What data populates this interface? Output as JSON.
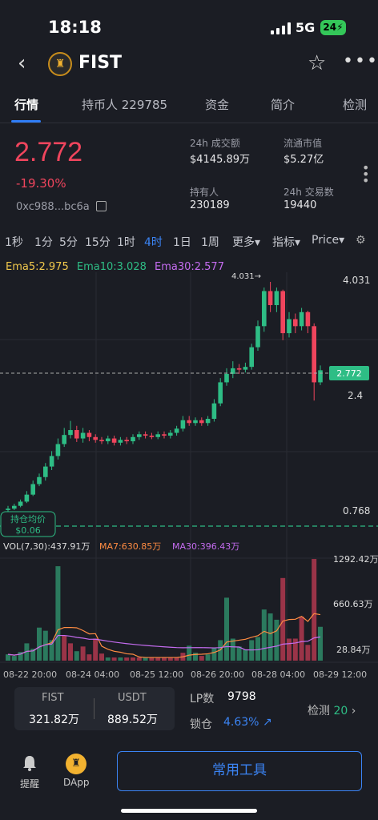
{
  "status": {
    "time": "18:18",
    "network": "5G",
    "battery": "24"
  },
  "header": {
    "title": "FIST",
    "logo_text": "♜"
  },
  "tabs": [
    {
      "label": "行情",
      "active": true
    },
    {
      "label": "持币人 229785"
    },
    {
      "label": "资金"
    },
    {
      "label": "简介"
    },
    {
      "label": "检测"
    }
  ],
  "overview": {
    "price": "2.772",
    "change": "-19.30%",
    "address": "0xc988...bc6a",
    "stats": [
      {
        "label": "24h 成交额",
        "value": "$4145.89万"
      },
      {
        "label": "流通市值",
        "value": "$5.27亿"
      },
      {
        "label": "持有人",
        "value": "230189"
      },
      {
        "label": "24h 交易数",
        "value": "19440"
      }
    ]
  },
  "timeframes": [
    "1秒",
    "1分",
    "5分",
    "15分",
    "1时",
    "4时",
    "1日",
    "1周",
    "更多▾",
    "指标▾",
    "Price▾"
  ],
  "active_timeframe": "4时",
  "ema": {
    "ema5": "Ema5:2.975",
    "ema10": "Ema10:3.028",
    "ema30": "Ema30:2.577"
  },
  "chart_labels": {
    "high_marker": "4.031→",
    "price_axis": [
      "4.031",
      "2.4",
      "0.768"
    ],
    "current_price": "2.772",
    "avg_cost_label": "持仓均价",
    "avg_cost_value": "$0.06",
    "vol": "VOL(7,30):437.91万",
    "ma7": "MA7:630.85万",
    "ma30": "MA30:396.43万",
    "vol_axis": [
      "1292.42万",
      "660.63万",
      "28.84万"
    ],
    "dates": [
      "08-22 20:00",
      "08-24 04:00",
      "08-25 12:00",
      "08-26 20:00",
      "08-28 04:00",
      "08-29 12:00"
    ]
  },
  "colors": {
    "up": "#2ebd85",
    "down": "#f0455d",
    "accent": "#3b84f4",
    "ema5": "#f2c94c",
    "ema10": "#2ebd85",
    "ema30": "#c56cf0",
    "ma7": "#ff8c42"
  },
  "chart_data": {
    "type": "candlestick",
    "price_range": [
      0.768,
      4.031
    ],
    "candles": [
      {
        "o": 0.78,
        "c": 0.8,
        "h": 0.84,
        "l": 0.76
      },
      {
        "o": 0.8,
        "c": 0.84,
        "h": 0.87,
        "l": 0.78
      },
      {
        "o": 0.84,
        "c": 0.9,
        "h": 0.93,
        "l": 0.82
      },
      {
        "o": 0.9,
        "c": 1.0,
        "h": 1.05,
        "l": 0.88
      },
      {
        "o": 1.0,
        "c": 1.15,
        "h": 1.2,
        "l": 0.98
      },
      {
        "o": 1.15,
        "c": 1.25,
        "h": 1.3,
        "l": 1.12
      },
      {
        "o": 1.25,
        "c": 1.4,
        "h": 1.45,
        "l": 1.2
      },
      {
        "o": 1.4,
        "c": 1.55,
        "h": 1.62,
        "l": 1.35
      },
      {
        "o": 1.55,
        "c": 1.72,
        "h": 1.8,
        "l": 1.5
      },
      {
        "o": 1.72,
        "c": 1.85,
        "h": 1.95,
        "l": 1.68
      },
      {
        "o": 1.85,
        "c": 1.92,
        "h": 2.05,
        "l": 1.8
      },
      {
        "o": 1.92,
        "c": 1.8,
        "h": 1.98,
        "l": 1.75
      },
      {
        "o": 1.8,
        "c": 1.88,
        "h": 1.95,
        "l": 1.74
      },
      {
        "o": 1.88,
        "c": 1.82,
        "h": 1.92,
        "l": 1.76
      },
      {
        "o": 1.82,
        "c": 1.78,
        "h": 1.86,
        "l": 1.74
      },
      {
        "o": 1.78,
        "c": 1.76,
        "h": 1.82,
        "l": 1.72
      },
      {
        "o": 1.76,
        "c": 1.8,
        "h": 1.84,
        "l": 1.72
      },
      {
        "o": 1.8,
        "c": 1.74,
        "h": 1.84,
        "l": 1.7
      },
      {
        "o": 1.74,
        "c": 1.78,
        "h": 1.82,
        "l": 1.7
      },
      {
        "o": 1.78,
        "c": 1.76,
        "h": 1.82,
        "l": 1.72
      },
      {
        "o": 1.76,
        "c": 1.82,
        "h": 1.86,
        "l": 1.72
      },
      {
        "o": 1.82,
        "c": 1.86,
        "h": 1.9,
        "l": 1.78
      },
      {
        "o": 1.86,
        "c": 1.84,
        "h": 1.9,
        "l": 1.8
      },
      {
        "o": 1.84,
        "c": 1.82,
        "h": 1.88,
        "l": 1.79
      },
      {
        "o": 1.82,
        "c": 1.86,
        "h": 1.9,
        "l": 1.79
      },
      {
        "o": 1.86,
        "c": 1.84,
        "h": 1.9,
        "l": 1.8
      },
      {
        "o": 1.84,
        "c": 1.88,
        "h": 1.92,
        "l": 1.8
      },
      {
        "o": 1.88,
        "c": 1.94,
        "h": 1.98,
        "l": 1.84
      },
      {
        "o": 1.94,
        "c": 2.06,
        "h": 2.12,
        "l": 1.9
      },
      {
        "o": 2.06,
        "c": 2.02,
        "h": 2.12,
        "l": 1.98
      },
      {
        "o": 2.02,
        "c": 2.06,
        "h": 2.1,
        "l": 1.98
      },
      {
        "o": 2.06,
        "c": 2.02,
        "h": 2.1,
        "l": 1.98
      },
      {
        "o": 2.02,
        "c": 2.08,
        "h": 2.12,
        "l": 1.98
      },
      {
        "o": 2.08,
        "c": 2.3,
        "h": 2.36,
        "l": 2.04
      },
      {
        "o": 2.3,
        "c": 2.6,
        "h": 2.66,
        "l": 2.26
      },
      {
        "o": 2.6,
        "c": 2.72,
        "h": 2.8,
        "l": 2.55
      },
      {
        "o": 2.72,
        "c": 2.8,
        "h": 2.9,
        "l": 2.66
      },
      {
        "o": 2.8,
        "c": 2.78,
        "h": 2.86,
        "l": 2.72
      },
      {
        "o": 2.78,
        "c": 2.82,
        "h": 2.88,
        "l": 2.74
      },
      {
        "o": 2.82,
        "c": 3.1,
        "h": 3.15,
        "l": 2.78
      },
      {
        "o": 3.1,
        "c": 3.4,
        "h": 3.48,
        "l": 3.05
      },
      {
        "o": 3.4,
        "c": 3.9,
        "h": 3.95,
        "l": 3.32
      },
      {
        "o": 3.9,
        "c": 3.7,
        "h": 4.031,
        "l": 3.6
      },
      {
        "o": 3.7,
        "c": 3.9,
        "h": 3.95,
        "l": 3.6
      },
      {
        "o": 3.9,
        "c": 3.3,
        "h": 3.92,
        "l": 3.2
      },
      {
        "o": 3.3,
        "c": 3.5,
        "h": 3.6,
        "l": 3.24
      },
      {
        "o": 3.5,
        "c": 3.4,
        "h": 3.58,
        "l": 3.3
      },
      {
        "o": 3.4,
        "c": 3.6,
        "h": 3.66,
        "l": 3.34
      },
      {
        "o": 3.6,
        "c": 3.4,
        "h": 3.62,
        "l": 3.3
      },
      {
        "o": 3.4,
        "c": 2.6,
        "h": 3.44,
        "l": 2.34
      },
      {
        "o": 2.6,
        "c": 2.772,
        "h": 2.84,
        "l": 2.56
      }
    ],
    "volume_range": [
      28.84,
      1292.42
    ],
    "volumes": [
      {
        "v": 80,
        "up": true
      },
      {
        "v": 60,
        "up": true
      },
      {
        "v": 110,
        "up": true
      },
      {
        "v": 220,
        "up": true
      },
      {
        "v": 150,
        "up": true
      },
      {
        "v": 420,
        "up": true
      },
      {
        "v": 380,
        "up": true
      },
      {
        "v": 260,
        "up": true
      },
      {
        "v": 1200,
        "up": true
      },
      {
        "v": 320,
        "up": false
      },
      {
        "v": 220,
        "up": false
      },
      {
        "v": 120,
        "up": true
      },
      {
        "v": 180,
        "up": false
      },
      {
        "v": 80,
        "up": false
      },
      {
        "v": 280,
        "up": false
      },
      {
        "v": 90,
        "up": false
      },
      {
        "v": 40,
        "up": true
      },
      {
        "v": 40,
        "up": false
      },
      {
        "v": 40,
        "up": true
      },
      {
        "v": 40,
        "up": false
      },
      {
        "v": 40,
        "up": false
      },
      {
        "v": 40,
        "up": false
      },
      {
        "v": 40,
        "up": true
      },
      {
        "v": 40,
        "up": false
      },
      {
        "v": 40,
        "up": false
      },
      {
        "v": 40,
        "up": false
      },
      {
        "v": 40,
        "up": false
      },
      {
        "v": 40,
        "up": false
      },
      {
        "v": 100,
        "up": false
      },
      {
        "v": 190,
        "up": true
      },
      {
        "v": 100,
        "up": true
      },
      {
        "v": 60,
        "up": false
      },
      {
        "v": 80,
        "up": true
      },
      {
        "v": 160,
        "up": true
      },
      {
        "v": 260,
        "up": true
      },
      {
        "v": 800,
        "up": true
      },
      {
        "v": 280,
        "up": true
      },
      {
        "v": 180,
        "up": true
      },
      {
        "v": 140,
        "up": true
      },
      {
        "v": 260,
        "up": true
      },
      {
        "v": 300,
        "up": true
      },
      {
        "v": 650,
        "up": true
      },
      {
        "v": 600,
        "up": true
      },
      {
        "v": 520,
        "up": true
      },
      {
        "v": 1050,
        "up": false
      },
      {
        "v": 280,
        "up": false
      },
      {
        "v": 280,
        "up": false
      },
      {
        "v": 560,
        "up": false
      },
      {
        "v": 200,
        "up": false
      },
      {
        "v": 1292,
        "up": false
      },
      {
        "v": 430,
        "up": true
      }
    ]
  },
  "footer": {
    "token_label": "FIST",
    "token_value": "321.82万",
    "usdt_label": "USDT",
    "usdt_value": "889.52万",
    "lp_label": "LP数",
    "lp_value": "9798",
    "lock_label": "锁仓",
    "lock_value": "4.63%",
    "detect_label": "检测",
    "detect_value": "20"
  },
  "bottom": {
    "remind": "提醒",
    "dapp": "DApp",
    "tools": "常用工具"
  }
}
